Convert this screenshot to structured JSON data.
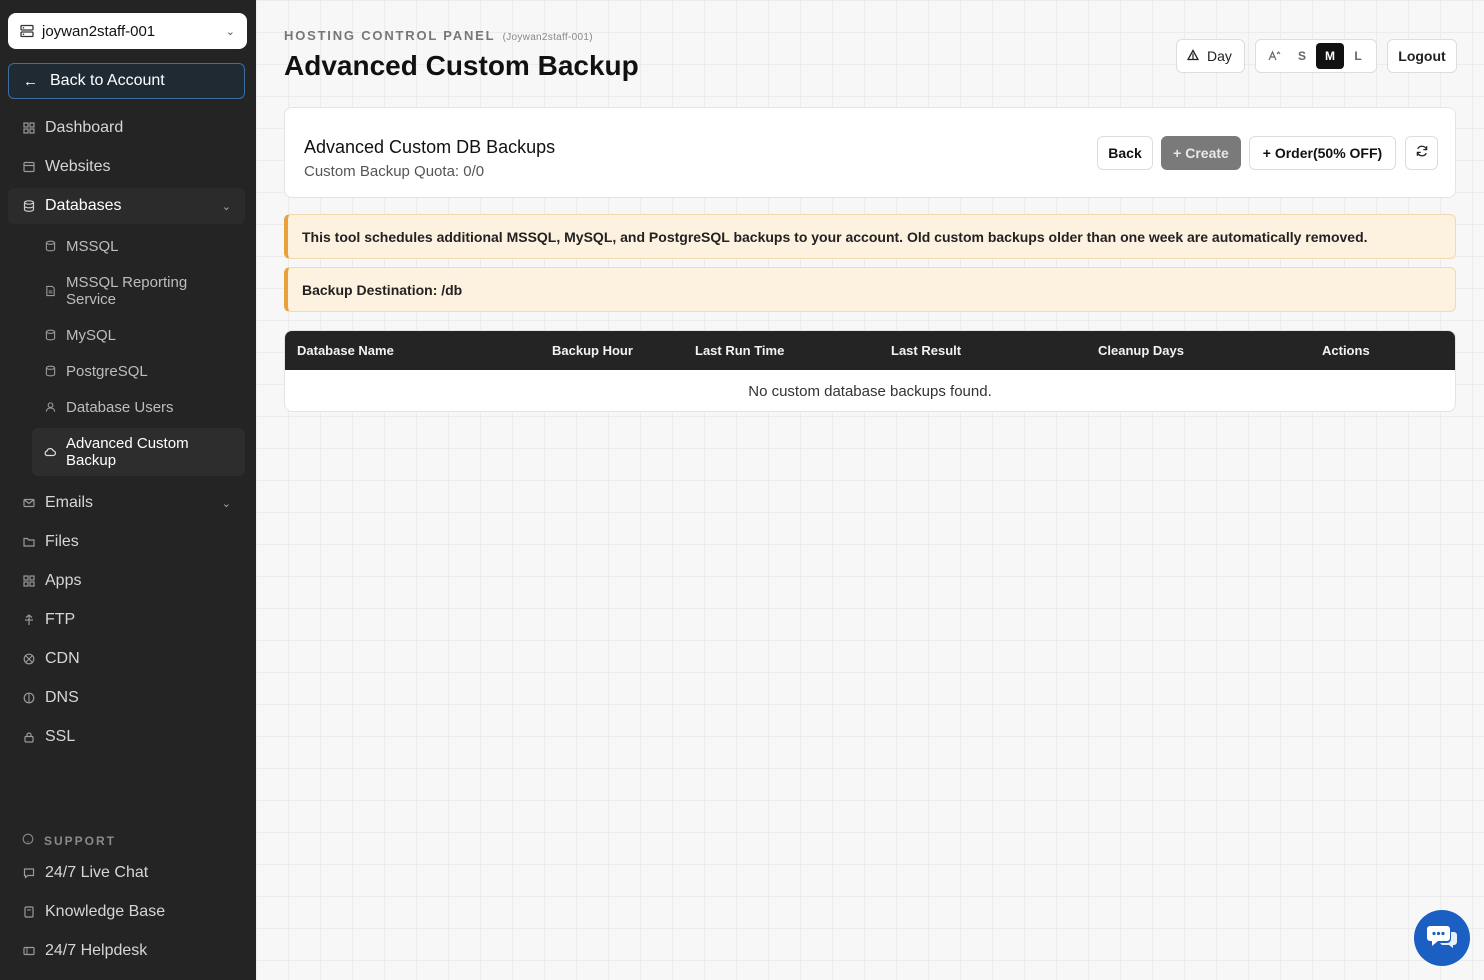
{
  "sidebar": {
    "account": "joywan2staff-001",
    "back_label": "Back to Account",
    "items": [
      {
        "label": "Dashboard"
      },
      {
        "label": "Websites"
      },
      {
        "label": "Databases"
      },
      {
        "label": "Emails"
      },
      {
        "label": "Files"
      },
      {
        "label": "Apps"
      },
      {
        "label": "FTP"
      },
      {
        "label": "CDN"
      },
      {
        "label": "DNS"
      },
      {
        "label": "SSL"
      }
    ],
    "db_sub": [
      {
        "label": "MSSQL"
      },
      {
        "label": "MSSQL Reporting Service"
      },
      {
        "label": "MySQL"
      },
      {
        "label": "PostgreSQL"
      },
      {
        "label": "Database Users"
      },
      {
        "label": "Advanced Custom Backup"
      }
    ],
    "support_label": "SUPPORT",
    "support": [
      {
        "label": "24/7 Live Chat"
      },
      {
        "label": "Knowledge Base"
      },
      {
        "label": "24/7 Helpdesk"
      }
    ]
  },
  "header": {
    "panel_label": "HOSTING CONTROL PANEL",
    "panel_sub": "(Joywan2staff-001)",
    "title": "Advanced Custom Backup",
    "day_label": "Day",
    "sizes": [
      "S",
      "M",
      "L"
    ],
    "selected_size": "M",
    "logout_label": "Logout"
  },
  "card": {
    "title": "Advanced Custom DB Backups",
    "quota": "Custom Backup Quota: 0/0",
    "back_label": "Back",
    "create_label": "+ Create",
    "order_label": "+ Order(50% OFF)"
  },
  "alerts": {
    "info": "This tool schedules additional MSSQL, MySQL, and PostgreSQL backups to your account. Old custom backups older than one week are automatically removed.",
    "destination": "Backup Destination: /db"
  },
  "table": {
    "columns": [
      "Database Name",
      "Backup Hour",
      "Last Run Time",
      "Last Result",
      "Cleanup Days",
      "Actions"
    ],
    "empty": "No custom database backups found."
  },
  "colors": {
    "sidebar_bg": "#242424",
    "accent_blue": "#1a5fc1",
    "alert_bg": "#fdf1df",
    "alert_border": "#e9a23b"
  }
}
